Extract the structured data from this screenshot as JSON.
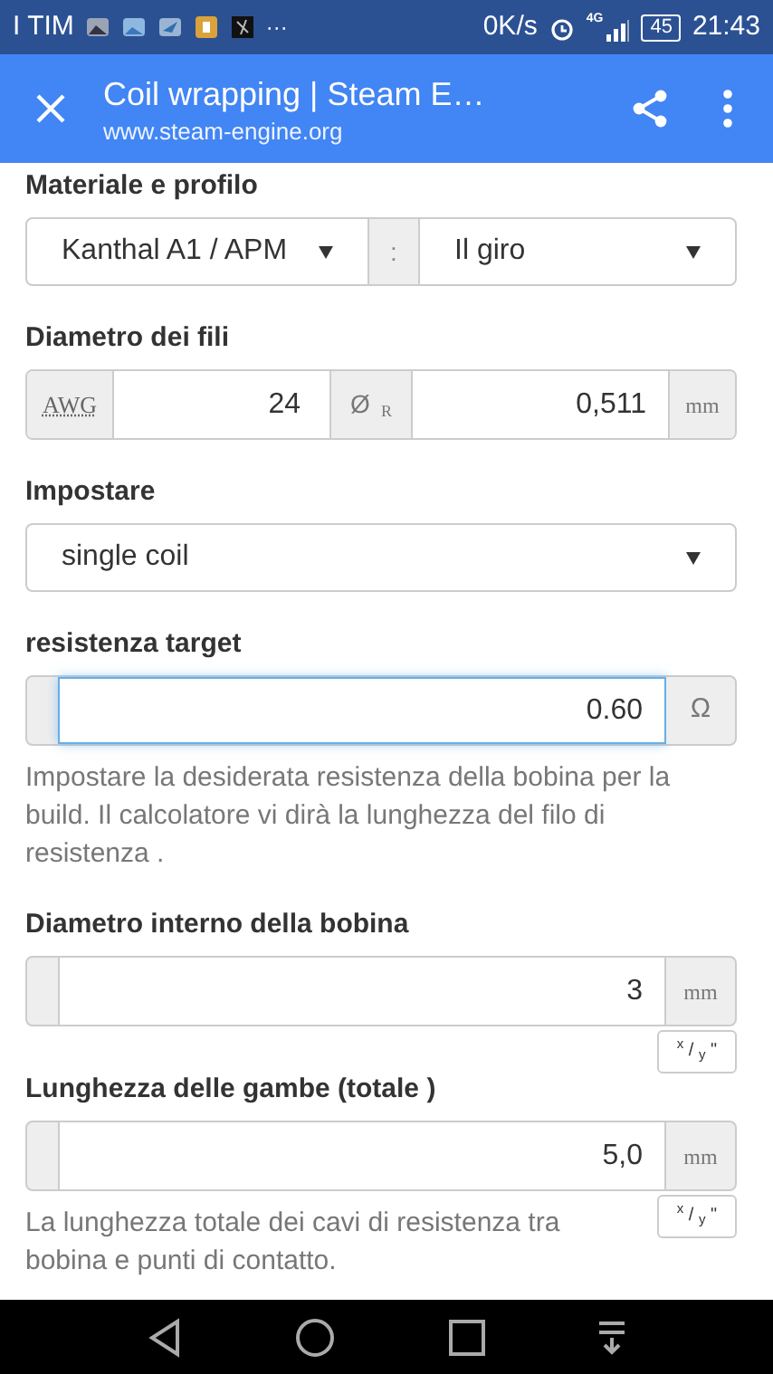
{
  "status_bar": {
    "carrier": "I TIM",
    "more": "···",
    "speed": "0K/s",
    "network": "4G",
    "battery": "45",
    "time": "21:43"
  },
  "toolbar": {
    "title": "Coil wrapping | Steam E…",
    "url": "www.steam-engine.org"
  },
  "sections": [
    {
      "kind": "select_pair",
      "label": "Materiale e profilo",
      "left": "Kanthal A1 / APM",
      "separator": ":",
      "right": "Il giro"
    },
    {
      "kind": "wire",
      "label": "Diametro dei fili",
      "prefix": "AWG",
      "value": "24",
      "mid": "Ø",
      "mid_sub": "R",
      "value2": "0,511",
      "unit": "mm"
    },
    {
      "kind": "select",
      "label": "Impostare",
      "value": "single coil"
    },
    {
      "kind": "input",
      "label": "resistenza target",
      "value": "0.60",
      "unit": "Ω",
      "focused": true,
      "help": "Impostare la desiderata resistenza della bobina per la build. Il calcolatore vi dirà la lunghezza del filo di resistenza ."
    },
    {
      "kind": "input",
      "label": "Diametro interno della bobina",
      "value": "3",
      "unit": "mm",
      "focused": false,
      "toggle": "$^{x}$ / $_{y}$ \""
    },
    {
      "kind": "input",
      "label": "Lunghezza delle gambe (totale )",
      "value": "5,0",
      "unit": "mm",
      "focused": false,
      "toggle": "$^{x}$ / $_{y}$ \"",
      "help": "La lunghezza totale dei cavi di resistenza tra bobina e punti di contatto."
    }
  ]
}
